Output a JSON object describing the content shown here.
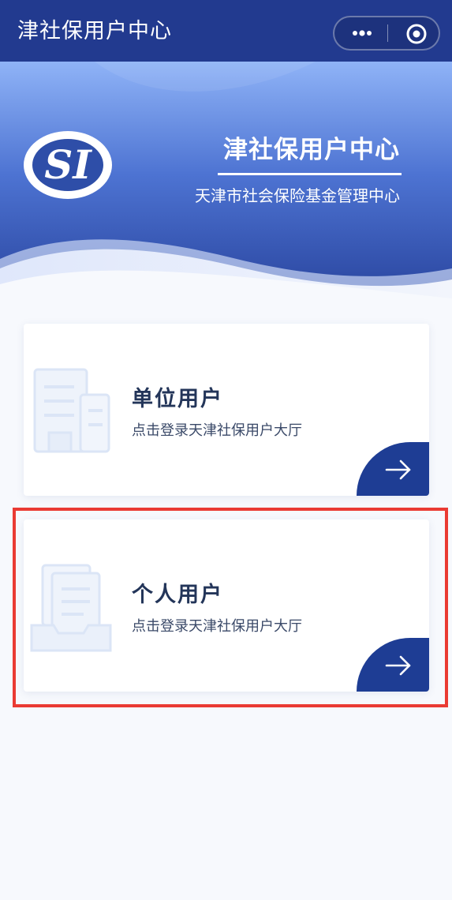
{
  "header": {
    "title": "津社保用户中心",
    "icons": [
      "more-dots-icon",
      "close-circle-icon"
    ]
  },
  "banner": {
    "logo_text": "SI",
    "title": "津社保用户中心",
    "subtitle": "天津市社会保险基金管理中心"
  },
  "cards": [
    {
      "title": "单位用户",
      "desc": "点击登录天津社保用户大厅",
      "icon": "building-icon",
      "arrow": "arrow-right-icon"
    },
    {
      "title": "个人用户",
      "desc": "点击登录天津社保用户大厅",
      "icon": "document-icon",
      "arrow": "arrow-right-icon"
    }
  ],
  "colors": {
    "topbar": "#223a8f",
    "banner_top": "#8fb3f7",
    "banner_bottom": "#253f98",
    "arrow_button": "#1e3d94",
    "highlight": "#ea3b33",
    "page_bg": "#f7f9fd"
  }
}
